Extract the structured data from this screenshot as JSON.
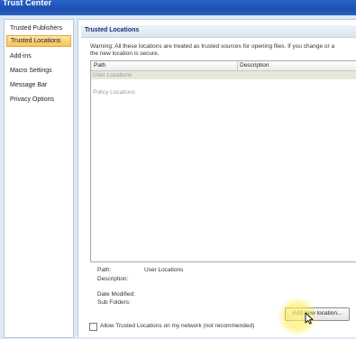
{
  "window": {
    "title": "Trust Center"
  },
  "sidebar": {
    "items": [
      {
        "label": "Trusted Publishers"
      },
      {
        "label": "Trusted Locations",
        "active": true
      },
      {
        "label": "Add-ins"
      },
      {
        "label": "Macro Settings"
      },
      {
        "label": "Message Bar"
      },
      {
        "label": "Privacy Options"
      }
    ]
  },
  "main": {
    "section_title": "Trusted Locations",
    "warning_line1": "Warning: All these locations are treated as trusted sources for opening files.  If you change or a",
    "warning_line2": "the new location is secure.",
    "table": {
      "columns": [
        "Path",
        "Description"
      ],
      "groups": [
        "User Locations",
        "Policy Locations"
      ]
    },
    "details": {
      "path_label": "Path:",
      "path_value": "User Locations",
      "description_label": "Description:",
      "date_modified_label": "Date Modified:",
      "sub_folders_label": "Sub Folders:"
    },
    "add_button_label": "Add new location...",
    "allow_network_label": "Allow Trusted Locations on my network (not recommended)",
    "allow_network_checked": false
  },
  "colors": {
    "titlebar": "#1c4fb0",
    "active_nav": "#fbd27a",
    "frame": "#dfe9f5"
  }
}
